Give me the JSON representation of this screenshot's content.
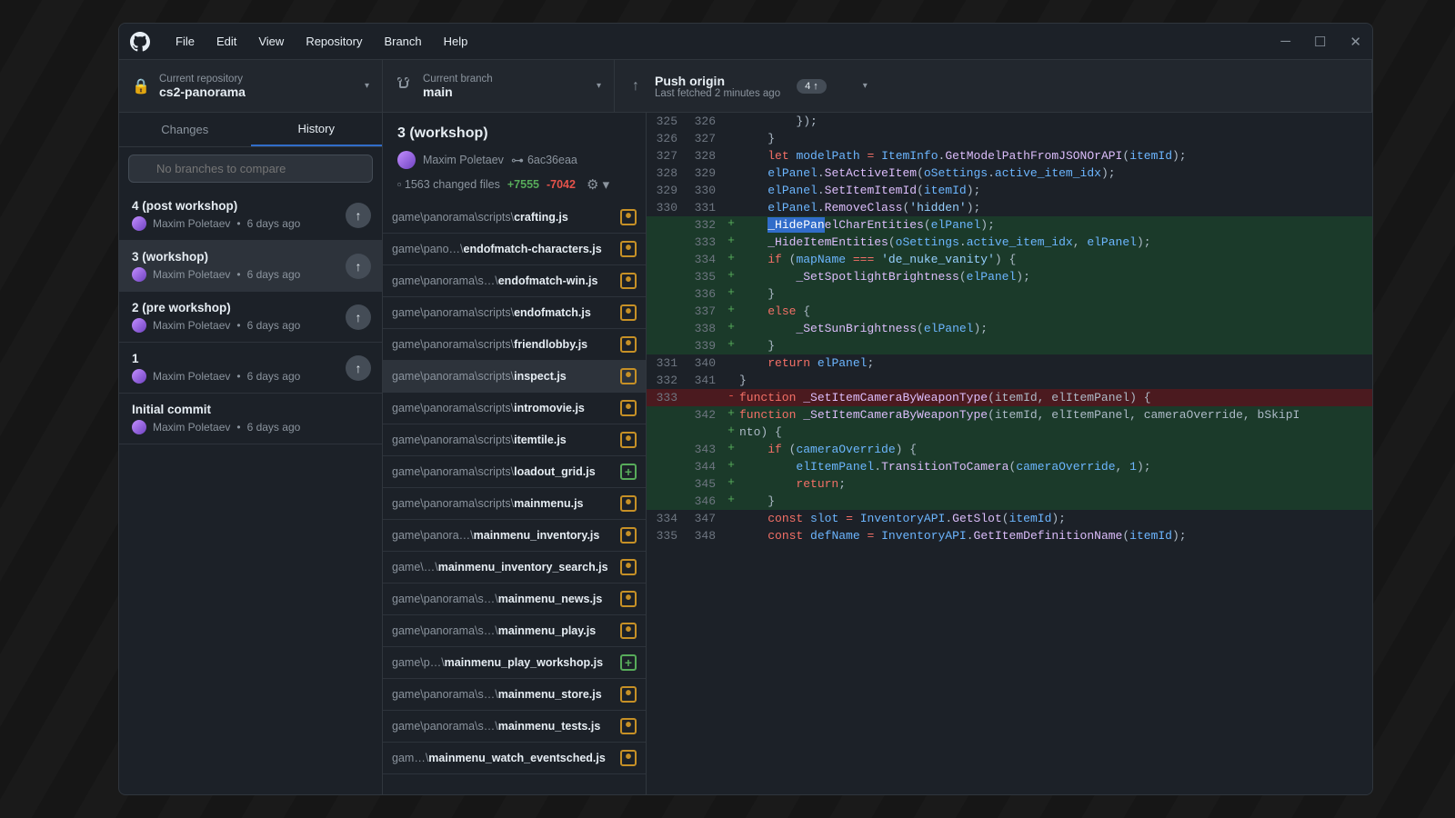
{
  "menus": [
    "File",
    "Edit",
    "View",
    "Repository",
    "Branch",
    "Help"
  ],
  "repo": {
    "label": "Current repository",
    "name": "cs2-panorama"
  },
  "branch": {
    "label": "Current branch",
    "name": "main"
  },
  "push": {
    "title": "Push origin",
    "sub": "Last fetched 2 minutes ago",
    "badge": "4 ↑"
  },
  "tabs": {
    "changes": "Changes",
    "history": "History"
  },
  "filter": {
    "placeholder": "No branches to compare"
  },
  "commits": [
    {
      "title": "4 (post workshop)",
      "author": "Maxim Poletaev",
      "time": "6 days ago",
      "push": true
    },
    {
      "title": "3 (workshop)",
      "author": "Maxim Poletaev",
      "time": "6 days ago",
      "push": true,
      "selected": true
    },
    {
      "title": "2 (pre workshop)",
      "author": "Maxim Poletaev",
      "time": "6 days ago",
      "push": true
    },
    {
      "title": "1",
      "author": "Maxim Poletaev",
      "time": "6 days ago",
      "push": true
    },
    {
      "title": "Initial commit",
      "author": "Maxim Poletaev",
      "time": "6 days ago",
      "push": false
    }
  ],
  "commit_header": {
    "title": "3 (workshop)",
    "author": "Maxim Poletaev",
    "sha": "6ac36eaa",
    "changed": "1563 changed files",
    "add": "+7555",
    "del": "-7042"
  },
  "files": [
    {
      "prefix": "game\\panorama\\scripts\\",
      "name": "crafting.js",
      "badge": "modified"
    },
    {
      "prefix": "game\\pano…\\",
      "name": "endofmatch-characters.js",
      "badge": "modified"
    },
    {
      "prefix": "game\\panorama\\s…\\",
      "name": "endofmatch-win.js",
      "badge": "modified"
    },
    {
      "prefix": "game\\panorama\\scripts\\",
      "name": "endofmatch.js",
      "badge": "modified"
    },
    {
      "prefix": "game\\panorama\\scripts\\",
      "name": "friendlobby.js",
      "badge": "modified"
    },
    {
      "prefix": "game\\panorama\\scripts\\",
      "name": "inspect.js",
      "badge": "modified",
      "selected": true
    },
    {
      "prefix": "game\\panorama\\scripts\\",
      "name": "intromovie.js",
      "badge": "modified"
    },
    {
      "prefix": "game\\panorama\\scripts\\",
      "name": "itemtile.js",
      "badge": "modified"
    },
    {
      "prefix": "game\\panorama\\scripts\\",
      "name": "loadout_grid.js",
      "badge": "added"
    },
    {
      "prefix": "game\\panorama\\scripts\\",
      "name": "mainmenu.js",
      "badge": "modified"
    },
    {
      "prefix": "game\\panora…\\",
      "name": "mainmenu_inventory.js",
      "badge": "modified"
    },
    {
      "prefix": "game\\…\\",
      "name": "mainmenu_inventory_search.js",
      "badge": "modified"
    },
    {
      "prefix": "game\\panorama\\s…\\",
      "name": "mainmenu_news.js",
      "badge": "modified"
    },
    {
      "prefix": "game\\panorama\\s…\\",
      "name": "mainmenu_play.js",
      "badge": "modified"
    },
    {
      "prefix": "game\\p…\\",
      "name": "mainmenu_play_workshop.js",
      "badge": "added"
    },
    {
      "prefix": "game\\panorama\\s…\\",
      "name": "mainmenu_store.js",
      "badge": "modified"
    },
    {
      "prefix": "game\\panorama\\s…\\",
      "name": "mainmenu_tests.js",
      "badge": "modified"
    },
    {
      "prefix": "gam…\\",
      "name": "mainmenu_watch_eventsched.js",
      "badge": "modified"
    }
  ],
  "diff": [
    {
      "o": "325",
      "n": "326",
      "s": " ",
      "html": "        });"
    },
    {
      "o": "326",
      "n": "327",
      "s": " ",
      "html": "    }"
    },
    {
      "o": "327",
      "n": "328",
      "s": " ",
      "html": "    <span class='tk-kw'>let</span> <span class='tk-var'>modelPath</span> <span class='tk-op'>=</span> <span class='tk-var'>ItemInfo</span>.<span class='tk-fn'>GetModelPathFromJSONOrAPI</span>(<span class='tk-var'>itemId</span>);"
    },
    {
      "o": "328",
      "n": "329",
      "s": " ",
      "html": "    <span class='tk-var'>elPanel</span>.<span class='tk-fn'>SetActiveItem</span>(<span class='tk-var'>oSettings</span>.<span class='tk-var'>active_item_idx</span>);"
    },
    {
      "o": "329",
      "n": "330",
      "s": " ",
      "html": "    <span class='tk-var'>elPanel</span>.<span class='tk-fn'>SetItemItemId</span>(<span class='tk-var'>itemId</span>);"
    },
    {
      "o": "330",
      "n": "331",
      "s": " ",
      "html": "    <span class='tk-var'>elPanel</span>.<span class='tk-fn'>RemoveClass</span>(<span class='tk-str'>'hidden'</span>);"
    },
    {
      "o": "",
      "n": "332",
      "s": "+",
      "html": "    <span class='selection'>_HidePan</span><span class='tk-fn'>elCharEntities</span>(<span class='tk-var'>elPanel</span>);"
    },
    {
      "o": "",
      "n": "333",
      "s": "+",
      "html": "    <span class='tk-fn'>_HideItemEntities</span>(<span class='tk-var'>oSettings</span>.<span class='tk-var'>active_item_idx</span>, <span class='tk-var'>elPanel</span>);"
    },
    {
      "o": "",
      "n": "334",
      "s": "+",
      "html": "    <span class='tk-kw'>if</span> (<span class='tk-var'>mapName</span> <span class='tk-op'>===</span> <span class='tk-str'>'de_nuke_vanity'</span>) {"
    },
    {
      "o": "",
      "n": "335",
      "s": "+",
      "html": "        <span class='tk-fn'>_SetSpotlightBrightness</span>(<span class='tk-var'>elPanel</span>);"
    },
    {
      "o": "",
      "n": "336",
      "s": "+",
      "html": "    }"
    },
    {
      "o": "",
      "n": "337",
      "s": "+",
      "html": "    <span class='tk-kw'>else</span> {"
    },
    {
      "o": "",
      "n": "338",
      "s": "+",
      "html": "        <span class='tk-fn'>_SetSunBrightness</span>(<span class='tk-var'>elPanel</span>);"
    },
    {
      "o": "",
      "n": "339",
      "s": "+",
      "html": "    }"
    },
    {
      "o": "331",
      "n": "340",
      "s": " ",
      "html": "    <span class='tk-kw'>return</span> <span class='tk-var'>elPanel</span>;"
    },
    {
      "o": "332",
      "n": "341",
      "s": " ",
      "html": "}"
    },
    {
      "o": "333",
      "n": "",
      "s": "-",
      "html": "<span class='tk-kw'>function</span> <span class='tk-fn'>_SetItemCameraByWeaponType</span>(itemId, elItemPanel) {"
    },
    {
      "o": "",
      "n": "342",
      "s": "+",
      "html": "<span class='tk-kw'>function</span> <span class='tk-fn'>_SetItemCameraByWeaponType</span>(itemId, elItemPanel, cameraOverride, bSkipI"
    },
    {
      "o": "",
      "n": "",
      "s": "+",
      "cont": true,
      "html": "nto) {"
    },
    {
      "o": "",
      "n": "343",
      "s": "+",
      "html": "    <span class='tk-kw'>if</span> (<span class='tk-var'>cameraOverride</span>) {"
    },
    {
      "o": "",
      "n": "344",
      "s": "+",
      "html": "        <span class='tk-var'>elItemPanel</span>.<span class='tk-fn'>TransitionToCamera</span>(<span class='tk-var'>cameraOverride</span>, <span class='tk-num'>1</span>);"
    },
    {
      "o": "",
      "n": "345",
      "s": "+",
      "html": "        <span class='tk-kw'>return</span>;"
    },
    {
      "o": "",
      "n": "346",
      "s": "+",
      "html": "    }"
    },
    {
      "o": "334",
      "n": "347",
      "s": " ",
      "html": "    <span class='tk-kw'>const</span> <span class='tk-var'>slot</span> <span class='tk-op'>=</span> <span class='tk-var'>InventoryAPI</span>.<span class='tk-fn'>GetSlot</span>(<span class='tk-var'>itemId</span>);"
    },
    {
      "o": "335",
      "n": "348",
      "s": " ",
      "html": "    <span class='tk-kw'>const</span> <span class='tk-var'>defName</span> <span class='tk-op'>=</span> <span class='tk-var'>InventoryAPI</span>.<span class='tk-fn'>GetItemDefinitionName</span>(<span class='tk-var'>itemId</span>);"
    }
  ]
}
